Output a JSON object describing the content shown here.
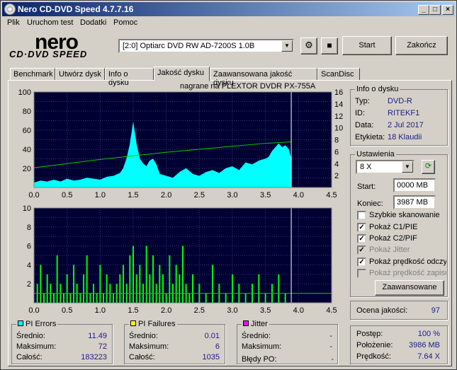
{
  "titlebar": {
    "title": "Nero CD-DVD Speed 4.7.7.16",
    "minimize": "_",
    "maximize": "□",
    "close": "×"
  },
  "menu": [
    "Plik",
    "Uruchom test",
    "Dodatki",
    "Pomoc"
  ],
  "logo": {
    "top": "nero",
    "bottom": "CD·DVD SPEED"
  },
  "drive": {
    "selected": "[2:0]  Optiarc DVD RW AD-7200S 1.0B"
  },
  "toolbar": {
    "start_label": "Start",
    "exit_label": "Zakończ"
  },
  "tabs": [
    "Benchmark",
    "Utwórz dysk",
    "Info o dysku",
    "Jakość dysku",
    "Zaawansowana jakość dysku",
    "ScanDisc"
  ],
  "active_tab": "Jakość dysku",
  "chart_caption": "nagrane na PLEXTOR  DVDR   PX-755A",
  "disc_info": {
    "title": "Info o dysku",
    "rows": [
      {
        "label": "Typ:",
        "value": "DVD-R"
      },
      {
        "label": "ID:",
        "value": "RITEKF1"
      },
      {
        "label": "Data:",
        "value": "2 Jul 2017"
      },
      {
        "label": "Etykieta:",
        "value": "18 Klaudii"
      }
    ]
  },
  "settings": {
    "title": "Ustawienia",
    "speed": "8 X",
    "start_label": "Start:",
    "start_value": "0000 MB",
    "end_label": "Koniec:",
    "end_value": "3987 MB",
    "checkboxes": [
      {
        "label": "Szybkie skanowanie",
        "checked": false,
        "enabled": true
      },
      {
        "label": "Pokaż C1/PIE",
        "checked": true,
        "enabled": true
      },
      {
        "label": "Pokaż C2/PIF",
        "checked": true,
        "enabled": true
      },
      {
        "label": "Pokaż Jitter",
        "checked": true,
        "enabled": false
      },
      {
        "label": "Pokaż prędkość odczy",
        "checked": true,
        "enabled": true
      },
      {
        "label": "Pokaż prędkość zapisu",
        "checked": false,
        "enabled": false
      }
    ],
    "advanced_label": "Zaawansowane"
  },
  "quality": {
    "label": "Ocena jakości:",
    "value": "97"
  },
  "progress": {
    "rows": [
      {
        "label": "Postęp:",
        "value": "100 %"
      },
      {
        "label": "Położenie:",
        "value": "3986 MB"
      },
      {
        "label": "Prędkość:",
        "value": "7.64 X"
      }
    ]
  },
  "pi_errors": {
    "title": "PI Errors",
    "color": "#00ffff",
    "rows": [
      {
        "label": "Średnio:",
        "value": "11.49"
      },
      {
        "label": "Maksimum:",
        "value": "72"
      },
      {
        "label": "Całość:",
        "value": "183223"
      }
    ]
  },
  "pi_failures": {
    "title": "PI Failures",
    "color": "#ffff00",
    "rows": [
      {
        "label": "Średnio:",
        "value": "0.01"
      },
      {
        "label": "Maksimum:",
        "value": "6"
      },
      {
        "label": "Całość:",
        "value": "1035"
      }
    ]
  },
  "jitter": {
    "title": "Jitter",
    "color": "#ff00ff",
    "rows": [
      {
        "label": "Średnio:",
        "value": "-"
      },
      {
        "label": "Maksimum:",
        "value": "-"
      }
    ],
    "po_label": "Błędy PO:",
    "po_value": "-"
  },
  "chart_data": [
    {
      "type": "area",
      "series": [
        {
          "name": "PI Errors",
          "color": "#00ffff",
          "x": [
            0.0,
            0.1,
            0.2,
            0.3,
            0.4,
            0.5,
            0.6,
            0.7,
            0.8,
            0.9,
            1.0,
            1.1,
            1.2,
            1.3,
            1.35,
            1.4,
            1.45,
            1.5,
            1.55,
            1.6,
            1.65,
            1.7,
            1.75,
            1.8,
            1.85,
            1.9,
            2.0,
            2.1,
            2.2,
            2.3,
            2.4,
            2.5,
            2.6,
            2.7,
            2.8,
            2.9,
            3.0,
            3.1,
            3.2,
            3.3,
            3.4,
            3.5,
            3.55,
            3.6,
            3.65,
            3.7,
            3.75,
            3.8,
            3.85,
            3.89
          ],
          "y": [
            5,
            7,
            6,
            8,
            6,
            9,
            7,
            8,
            10,
            9,
            8,
            11,
            12,
            15,
            20,
            30,
            45,
            68,
            45,
            30,
            25,
            22,
            28,
            30,
            24,
            14,
            12,
            10,
            16,
            20,
            14,
            12,
            16,
            18,
            15,
            20,
            22,
            18,
            26,
            24,
            28,
            30,
            32,
            38,
            42,
            46,
            42,
            44,
            40,
            30
          ]
        },
        {
          "name": "Prędkość",
          "color": "#00cc00",
          "axis": "right",
          "x": [
            0.0,
            0.5,
            1.0,
            1.5,
            2.0,
            2.5,
            3.0,
            3.5,
            3.89
          ],
          "y": [
            3.3,
            4.0,
            4.7,
            5.3,
            5.9,
            6.4,
            6.9,
            7.4,
            7.64
          ]
        }
      ],
      "xlim": [
        0,
        4.5
      ],
      "ylim": [
        0,
        100
      ],
      "y2lim": [
        0,
        16
      ],
      "xticks": [
        "0.0",
        "0.5",
        "1.0",
        "1.5",
        "2.0",
        "2.5",
        "3.0",
        "3.5",
        "4.0",
        "4.5"
      ],
      "yticks": [
        "20",
        "40",
        "60",
        "80",
        "100"
      ],
      "y2ticks": [
        "2",
        "4",
        "6",
        "8",
        "10",
        "12",
        "14",
        "16"
      ],
      "grid": true
    },
    {
      "type": "bar",
      "series": [
        {
          "name": "PI Failures",
          "color": "#00ff00",
          "x": [
            0.05,
            0.1,
            0.15,
            0.2,
            0.25,
            0.3,
            0.35,
            0.4,
            0.45,
            0.5,
            0.55,
            0.6,
            0.65,
            0.7,
            0.75,
            0.8,
            0.85,
            0.9,
            0.95,
            1.0,
            1.05,
            1.1,
            1.15,
            1.2,
            1.25,
            1.3,
            1.35,
            1.4,
            1.45,
            1.5,
            1.55,
            1.6,
            1.65,
            1.7,
            1.75,
            1.8,
            1.85,
            1.9,
            1.95,
            2.0,
            2.05,
            2.1,
            2.15,
            2.2,
            2.25,
            2.3,
            2.35,
            2.4,
            2.5,
            2.6,
            2.7,
            2.8,
            2.9,
            3.0,
            3.1,
            3.2,
            3.3,
            3.4,
            3.5,
            3.6,
            3.7,
            3.8
          ],
          "y": [
            2,
            4,
            1,
            3,
            2,
            1,
            5,
            2,
            1,
            3,
            1,
            4,
            2,
            1,
            3,
            5,
            1,
            2,
            1,
            4,
            1,
            3,
            2,
            1,
            2,
            3,
            4,
            2,
            5,
            6,
            3,
            4,
            2,
            6,
            3,
            5,
            2,
            4,
            3,
            1,
            5,
            2,
            4,
            3,
            6,
            2,
            1,
            3,
            2,
            1,
            4,
            2,
            1,
            3,
            2,
            1,
            2,
            3,
            1,
            2,
            3,
            1
          ]
        },
        {
          "name": "Prędkość",
          "color": "#00cc00",
          "axis": "right",
          "x": [
            0.0,
            4.5
          ],
          "y": [
            1,
            1
          ]
        }
      ],
      "xlim": [
        0,
        4.5
      ],
      "ylim": [
        0,
        10
      ],
      "xticks": [
        "0.0",
        "0.5",
        "1.0",
        "1.5",
        "2.0",
        "2.5",
        "3.0",
        "3.5",
        "4.0",
        "4.5"
      ],
      "yticks": [
        "2",
        "4",
        "6",
        "8",
        "10"
      ],
      "grid": true
    }
  ]
}
